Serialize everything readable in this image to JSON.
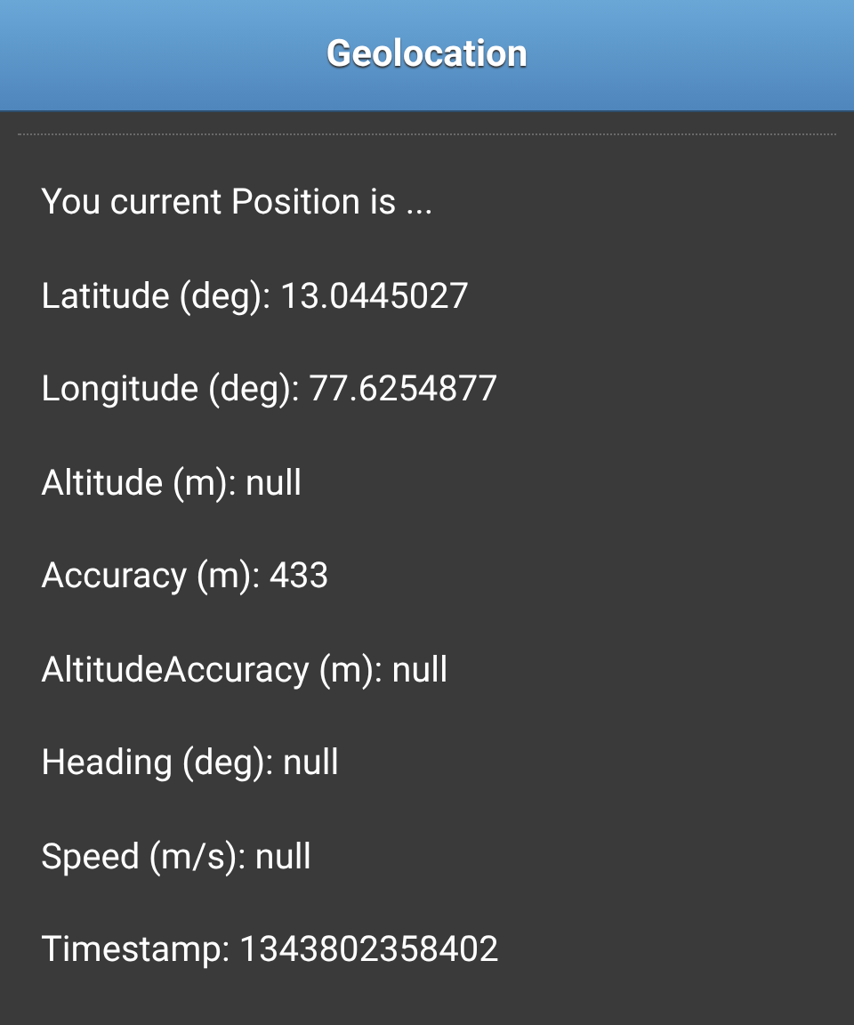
{
  "header": {
    "title": "Geolocation"
  },
  "lines": [
    "You current Position is ...",
    "Latitude (deg): 13.0445027",
    "Longitude (deg): 77.6254877",
    "Altitude (m): null",
    "Accuracy (m): 433",
    "AltitudeAccuracy (m): null",
    "Heading (deg): null",
    "Speed (m/s): null",
    "Timestamp: 1343802358402"
  ]
}
